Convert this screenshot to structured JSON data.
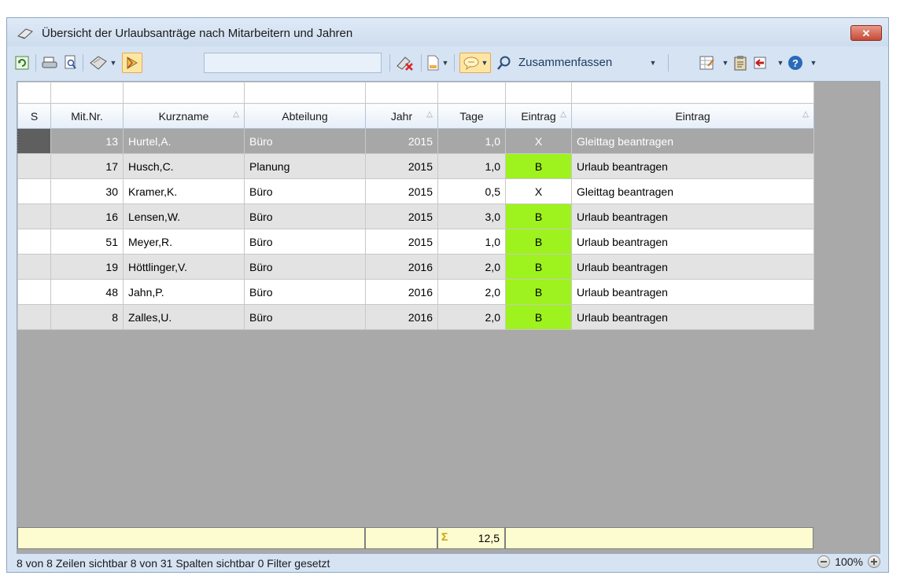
{
  "window": {
    "title": "Übersicht der Urlaubsanträge nach Mitarbeitern und Jahren",
    "close_label": "✕"
  },
  "toolbar": {
    "search_value": "",
    "zusammenfassen_label": "Zusammenfassen",
    "icons": [
      "refresh-icon",
      "print-icon",
      "print-preview-icon",
      "export-icon",
      "dropdown",
      "highlight-toggle",
      "filter-remove-icon",
      "document-icon",
      "comment-toggle",
      "search-icon",
      "layout-icon",
      "clipboard-icon",
      "exit-icon",
      "help-icon"
    ]
  },
  "columns": [
    {
      "label": "S",
      "sort": false
    },
    {
      "label": "Mit.Nr.",
      "sort": false
    },
    {
      "label": "Kurzname",
      "sort": true
    },
    {
      "label": "Abteilung",
      "sort": false
    },
    {
      "label": "Jahr",
      "sort": true
    },
    {
      "label": "Tage",
      "sort": false
    },
    {
      "label": "Eintrag",
      "sort": true
    },
    {
      "label": "Eintrag",
      "sort": true
    }
  ],
  "rows": [
    {
      "nr": "13",
      "name": "Hurtel,A.",
      "abt": "Büro",
      "jahr": "2015",
      "tage": "1,0",
      "code": "X",
      "eintrag": "Gleittag beantragen",
      "selected": true,
      "green": false
    },
    {
      "nr": "17",
      "name": "Husch,C.",
      "abt": "Planung",
      "jahr": "2015",
      "tage": "1,0",
      "code": "B",
      "eintrag": "Urlaub beantragen",
      "selected": false,
      "green": true
    },
    {
      "nr": "30",
      "name": "Kramer,K.",
      "abt": "Büro",
      "jahr": "2015",
      "tage": "0,5",
      "code": "X",
      "eintrag": "Gleittag beantragen",
      "selected": false,
      "green": false
    },
    {
      "nr": "16",
      "name": "Lensen,W.",
      "abt": "Büro",
      "jahr": "2015",
      "tage": "3,0",
      "code": "B",
      "eintrag": "Urlaub beantragen",
      "selected": false,
      "green": true
    },
    {
      "nr": "51",
      "name": "Meyer,R.",
      "abt": "Büro",
      "jahr": "2015",
      "tage": "1,0",
      "code": "B",
      "eintrag": "Urlaub beantragen",
      "selected": false,
      "green": true
    },
    {
      "nr": "19",
      "name": "Höttlinger,V.",
      "abt": "Büro",
      "jahr": "2016",
      "tage": "2,0",
      "code": "B",
      "eintrag": "Urlaub beantragen",
      "selected": false,
      "green": true
    },
    {
      "nr": "48",
      "name": "Jahn,P.",
      "abt": "Büro",
      "jahr": "2016",
      "tage": "2,0",
      "code": "B",
      "eintrag": "Urlaub beantragen",
      "selected": false,
      "green": true
    },
    {
      "nr": "8",
      "name": "Zalles,U.",
      "abt": "Büro",
      "jahr": "2016",
      "tage": "2,0",
      "code": "B",
      "eintrag": "Urlaub beantragen",
      "selected": false,
      "green": true
    }
  ],
  "summary": {
    "sigma": "Σ",
    "total_tage": "12,5"
  },
  "status": {
    "text": "8 von 8 Zeilen sichtbar  8 von 31 Spalten sichtbar   0 Filter gesetzt",
    "zoom": "100%"
  },
  "colors": {
    "green": "#9ef21e",
    "accent": "#fde6a4"
  }
}
